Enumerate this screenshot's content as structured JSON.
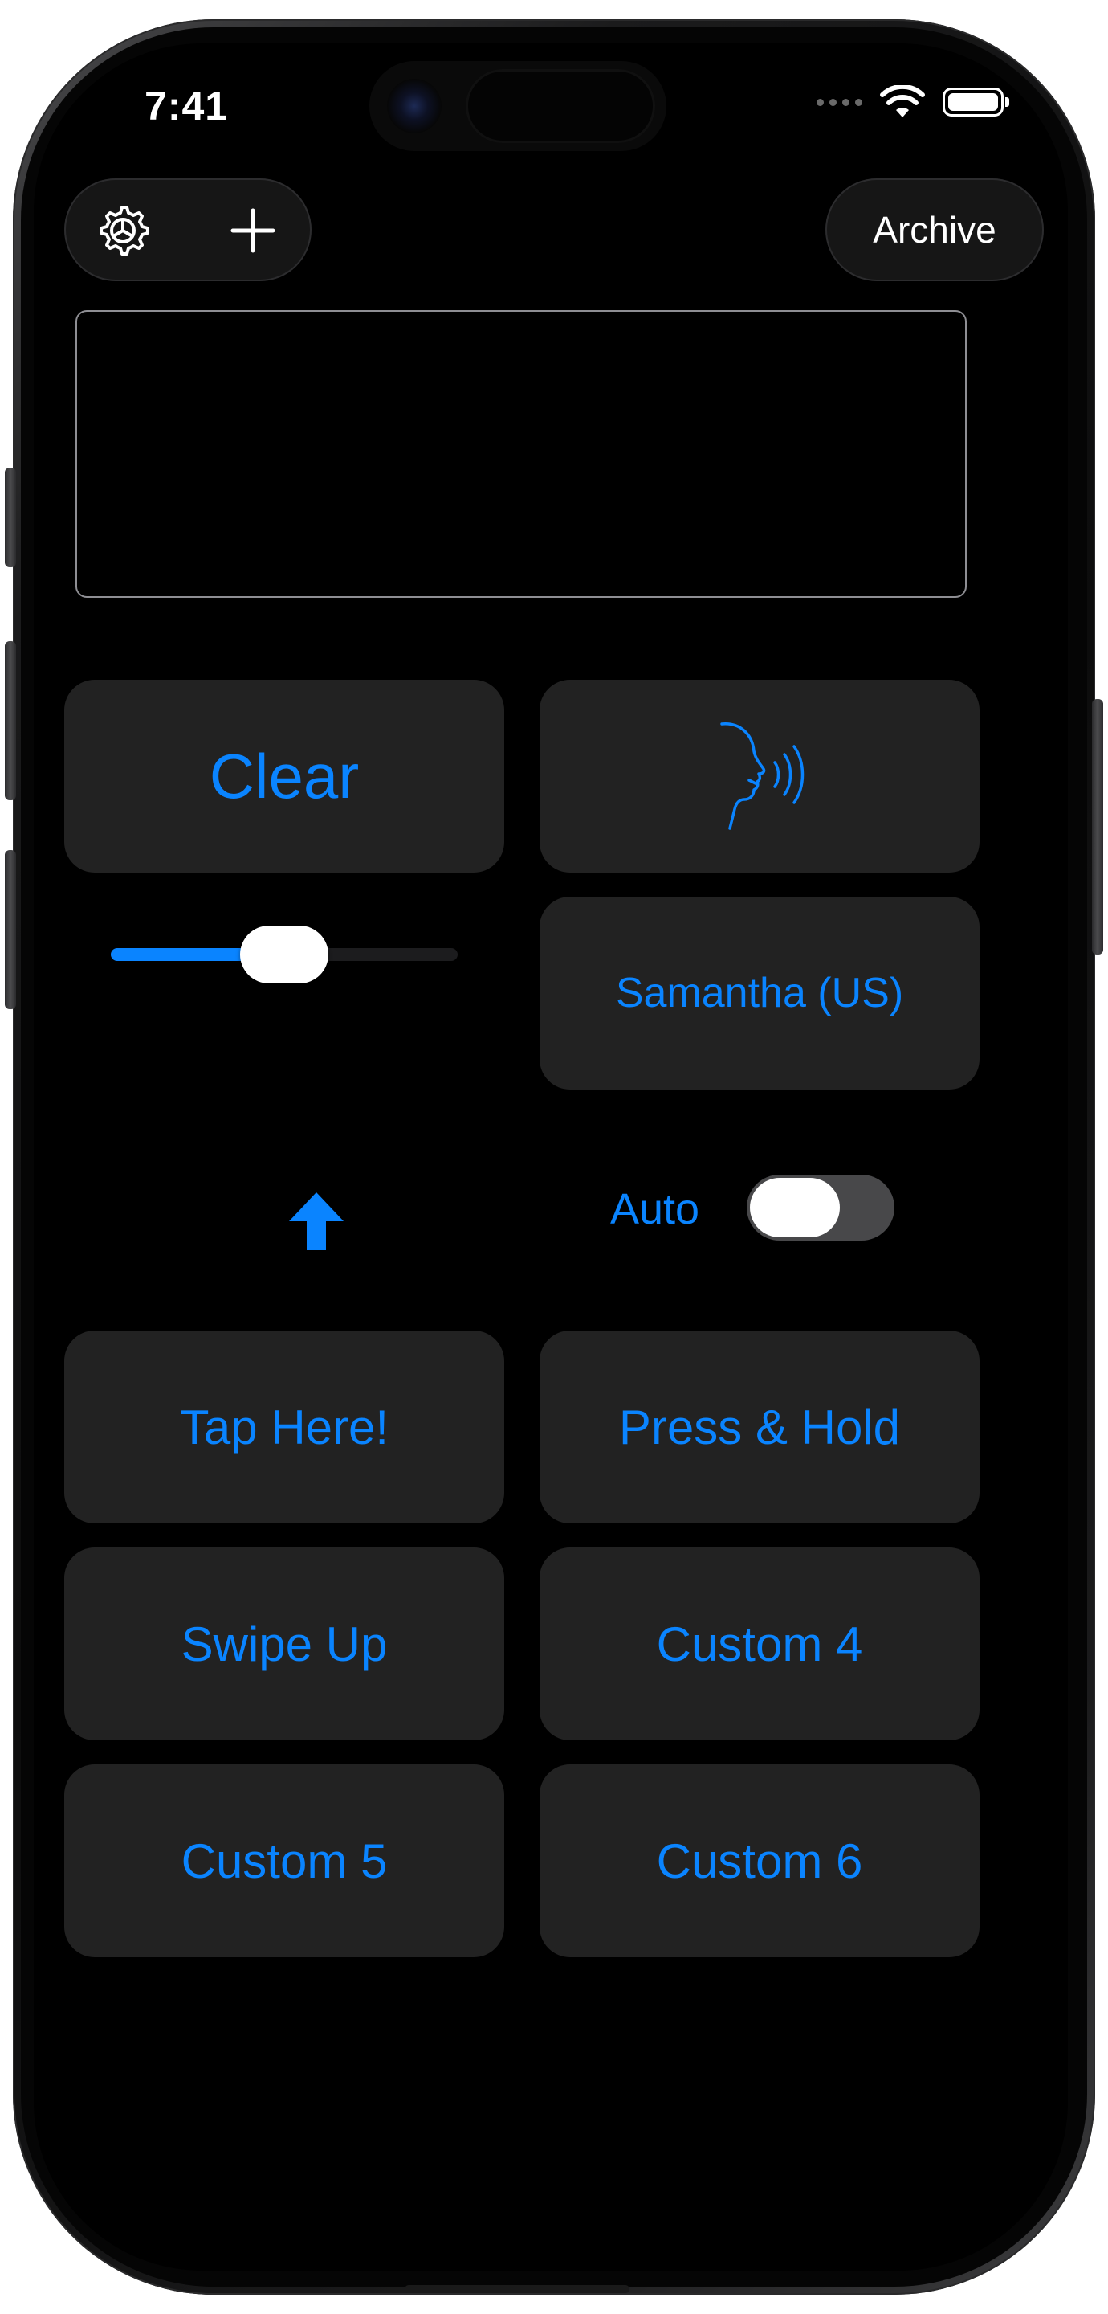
{
  "status_bar": {
    "time": "7:41"
  },
  "toolbar": {
    "settings_icon": "gear-icon",
    "add_icon": "plus-icon",
    "archive_label": "Archive"
  },
  "text_area": {
    "value": "",
    "placeholder": ""
  },
  "tiles": {
    "clear_label": "Clear",
    "speak_icon": "speaking-head-icon",
    "voice_label": "Samantha (US)",
    "tap_label": "Tap Here!",
    "press_label": "Press & Hold",
    "swipe_label": "Swipe Up",
    "custom4_label": "Custom 4",
    "custom5_label": "Custom 5",
    "custom6_label": "Custom 6"
  },
  "slider": {
    "value": 0.5
  },
  "up_arrow_icon": "up-arrow-icon",
  "auto_toggle": {
    "label": "Auto",
    "on": false
  },
  "colors": {
    "accent": "#0a84ff",
    "tile_bg": "#222222",
    "background": "#000000",
    "toggle_off": "#48484a"
  }
}
